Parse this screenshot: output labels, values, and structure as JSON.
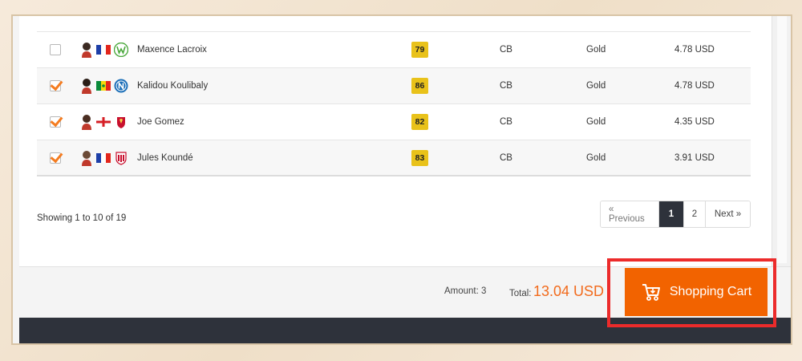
{
  "players": [
    {
      "name": "Maxence Lacroix",
      "rating": "79",
      "position": "CB",
      "version": "Gold",
      "price": "4.78 USD",
      "checked": false,
      "flag": "fr",
      "club": "wolfsburg",
      "skin": "#3b2a22"
    },
    {
      "name": "Kalidou Koulibaly",
      "rating": "86",
      "position": "CB",
      "version": "Gold",
      "price": "4.78 USD",
      "checked": true,
      "flag": "sn",
      "club": "napoli",
      "skin": "#2a1d17"
    },
    {
      "name": "Joe Gomez",
      "rating": "82",
      "position": "CB",
      "version": "Gold",
      "price": "4.35 USD",
      "checked": true,
      "flag": "en",
      "club": "liverpool",
      "skin": "#4a2e22"
    },
    {
      "name": "Jules Koundé",
      "rating": "83",
      "position": "CB",
      "version": "Gold",
      "price": "3.91 USD",
      "checked": true,
      "flag": "fr",
      "club": "sevilla",
      "skin": "#6b4a36"
    }
  ],
  "footer": {
    "showing": "Showing 1 to 10 of 19"
  },
  "pagination": {
    "prev": "« Previous",
    "pages": [
      "1",
      "2"
    ],
    "active": "1",
    "next": "Next »"
  },
  "summary": {
    "amount": "Amount: 3",
    "total_label": "Total:",
    "total_value": "13.04 USD"
  },
  "cart": {
    "label": "Shopping Cart"
  },
  "colors": {
    "accent": "#f26300",
    "rating_bg": "#e9c21a",
    "dark": "#2e323b",
    "highlight": "#ec2b2b"
  }
}
